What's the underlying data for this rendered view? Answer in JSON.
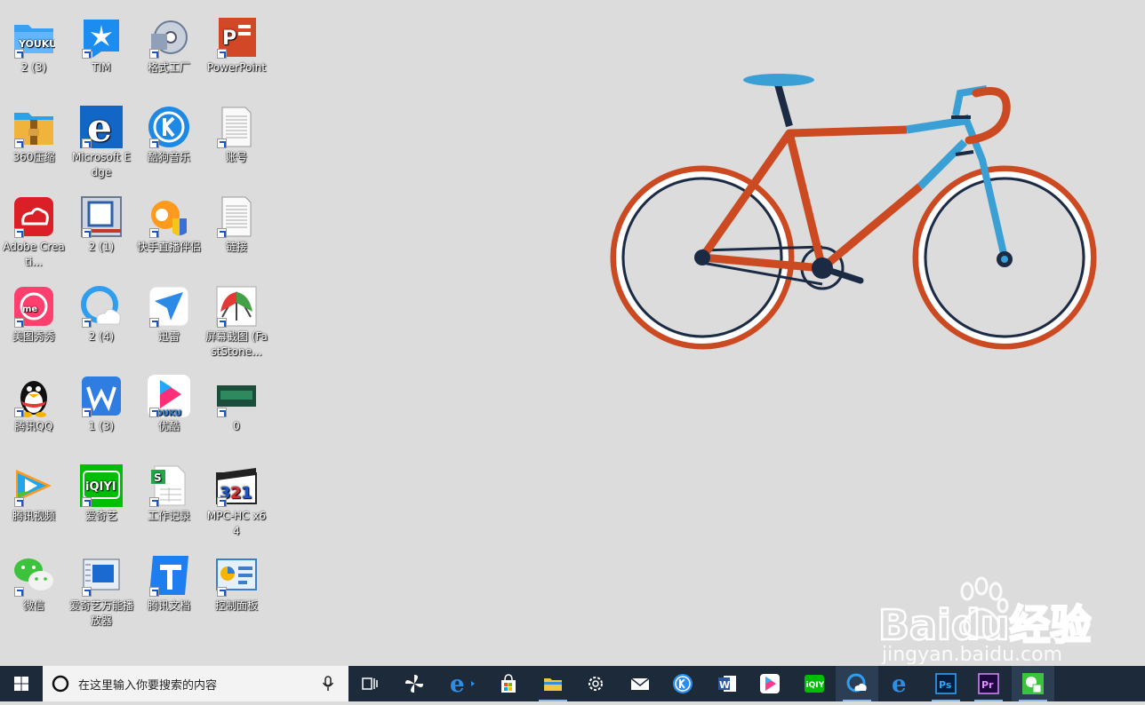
{
  "desktop": {
    "icons": [
      {
        "label": "2 (3)",
        "icon": "youku-folder-icon"
      },
      {
        "label": "TIM",
        "icon": "tim-icon"
      },
      {
        "label": "格式工厂",
        "icon": "format-factory-icon"
      },
      {
        "label": "PowerPoint",
        "icon": "powerpoint-icon"
      },
      {
        "label": "360压缩",
        "icon": "zip-360-icon"
      },
      {
        "label": "Microsoft Edge",
        "icon": "edge-icon"
      },
      {
        "label": "酷狗音乐",
        "icon": "kugou-icon"
      },
      {
        "label": "账号",
        "icon": "text-file-icon"
      },
      {
        "label": "Adobe Creati...",
        "icon": "adobe-cc-icon"
      },
      {
        "label": "2 (1)",
        "icon": "window-image-icon"
      },
      {
        "label": "快手直播伴侣",
        "icon": "kuaishou-icon"
      },
      {
        "label": "链接",
        "icon": "text-file-icon"
      },
      {
        "label": "美图秀秀",
        "icon": "meitu-icon"
      },
      {
        "label": "2 (4)",
        "icon": "cloud-icon"
      },
      {
        "label": "迅雷",
        "icon": "xunlei-icon"
      },
      {
        "label": "屏幕截图 (FastStone...",
        "icon": "faststone-icon"
      },
      {
        "label": "腾讯QQ",
        "icon": "qq-penguin-icon"
      },
      {
        "label": "1 (3)",
        "icon": "wps-icon"
      },
      {
        "label": "优酷",
        "icon": "youku-icon"
      },
      {
        "label": "0",
        "icon": "image-thumbnail-icon"
      },
      {
        "label": "腾讯视频",
        "icon": "tencent-video-icon"
      },
      {
        "label": "爱奇艺",
        "icon": "iqiyi-icon"
      },
      {
        "label": "工作记录",
        "icon": "spreadsheet-file-icon"
      },
      {
        "label": "MPC-HC x64",
        "icon": "mpc-hc-icon"
      },
      {
        "label": "微信",
        "icon": "wechat-icon"
      },
      {
        "label": "爱奇艺万能播放器",
        "icon": "iqiyi-player-icon"
      },
      {
        "label": "腾讯文档",
        "icon": "tencent-docs-icon"
      },
      {
        "label": "控制面板",
        "icon": "control-panel-icon"
      }
    ]
  },
  "wallpaper": {
    "subject": "bicycle",
    "colors": {
      "frame_red": "#cc4a22",
      "frame_blue": "#3a9fd4",
      "tire_dark": "#1c2b44",
      "rim_red": "#cc4a22",
      "background": "#dcdcdc"
    }
  },
  "watermark": {
    "brand": "Baidu经验",
    "url": "jingyan.baidu.com"
  },
  "taskbar": {
    "search_placeholder": "在这里输入你要搜索的内容",
    "items": [
      {
        "name": "task-view"
      },
      {
        "name": "pinwheel-app"
      },
      {
        "name": "ie-browser"
      },
      {
        "name": "microsoft-store"
      },
      {
        "name": "file-explorer"
      },
      {
        "name": "settings"
      },
      {
        "name": "mail"
      },
      {
        "name": "kugou"
      },
      {
        "name": "word"
      },
      {
        "name": "youku"
      },
      {
        "name": "iqiyi"
      },
      {
        "name": "browser-cloud"
      },
      {
        "name": "edge"
      },
      {
        "name": "photoshop"
      },
      {
        "name": "premiere"
      },
      {
        "name": "wechat-work"
      }
    ],
    "labels": {
      "photoshop": "Ps",
      "premiere": "Pr",
      "word": "W"
    }
  }
}
